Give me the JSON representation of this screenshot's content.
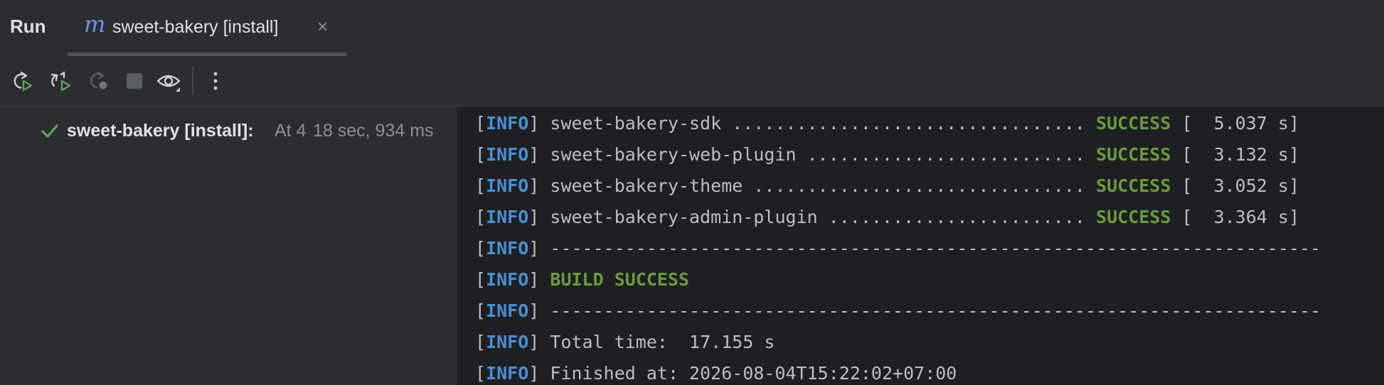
{
  "header": {
    "run_label": "Run",
    "tab": {
      "icon": "maven-m-icon",
      "icon_glyph": "m",
      "label": "sweet-bakery [install]",
      "close_glyph": "×"
    }
  },
  "toolbar": {
    "buttons": [
      {
        "name": "rerun-icon"
      },
      {
        "name": "rerun-failed-icon"
      },
      {
        "name": "rerun-debug-icon"
      },
      {
        "name": "stop-icon"
      },
      {
        "name": "view-options-icon"
      },
      {
        "name": "more-options-icon"
      }
    ]
  },
  "tree": {
    "item": {
      "name": "sweet-bakery [install]:",
      "at": "At 4",
      "time": "18 sec, 934 ms"
    }
  },
  "console": {
    "info_tag": "INFO",
    "lines": [
      {
        "text": " sweet-bakery-sdk ................................. ",
        "status": "SUCCESS",
        "tail": " [  5.037 s]"
      },
      {
        "text": " sweet-bakery-web-plugin .......................... ",
        "status": "SUCCESS",
        "tail": " [  3.132 s]"
      },
      {
        "text": " sweet-bakery-theme ............................... ",
        "status": "SUCCESS",
        "tail": " [  3.052 s]"
      },
      {
        "text": " sweet-bakery-admin-plugin ........................ ",
        "status": "SUCCESS",
        "tail": " [  3.364 s]"
      },
      {
        "text": " ------------------------------------------------------------------------",
        "status": "",
        "tail": ""
      },
      {
        "text": " ",
        "status": "BUILD SUCCESS",
        "tail": ""
      },
      {
        "text": " ------------------------------------------------------------------------",
        "status": "",
        "tail": ""
      },
      {
        "text": " Total time:  17.155 s",
        "status": "",
        "tail": ""
      },
      {
        "text": " Finished at: 2026-08-04T15:22:02+07:00",
        "status": "",
        "tail": ""
      }
    ]
  },
  "colors": {
    "info": "#4a8fd4",
    "success": "#6a9a3e",
    "check": "#5fa35f"
  }
}
